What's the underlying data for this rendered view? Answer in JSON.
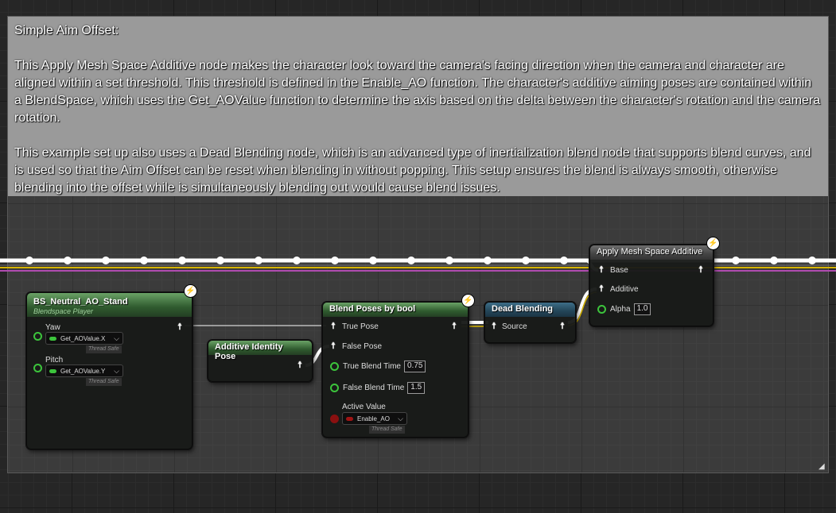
{
  "comment": {
    "title": "Simple Aim Offset:",
    "paragraph1": "This Apply Mesh Space Additive node makes the character look toward the camera's facing direction when the camera and character are aligned within a set threshold. This threshold is defined in the Enable_AO function. The character's additive aiming poses are contained within a BlendSpace, which uses the Get_AOValue function to determine the axis based on the delta between the character's rotation and the camera rotation.",
    "paragraph2": "This example set up also uses a Dead Blending node, which is an advanced type of inertialization blend node that supports blend curves, and is used so that the Aim Offset can be reset when blending in without popping. This setup ensures the blend is always smooth, otherwise blending into the offset while is simultaneously blending out would cause blend issues.",
    "resize_glyph": "◢"
  },
  "nodes": {
    "blendspace": {
      "title": "BS_Neutral_AO_Stand",
      "subtitle": "Blendspace Player",
      "yaw_label": "Yaw",
      "yaw_function": "Get_AOValue.X",
      "pitch_label": "Pitch",
      "pitch_function": "Get_AOValue.Y",
      "thread_safe": "Thread Safe"
    },
    "additive_identity": {
      "title": "Additive Identity Pose"
    },
    "blend_poses": {
      "title": "Blend Poses by bool",
      "true_pose": "True Pose",
      "false_pose": "False Pose",
      "true_blend_time_label": "True Blend Time",
      "true_blend_time": "0.75",
      "false_blend_time_label": "False Blend Time",
      "false_blend_time": "1.5",
      "active_value_label": "Active Value",
      "active_value_function": "Enable_AO",
      "thread_safe": "Thread Safe"
    },
    "dead_blending": {
      "title": "Dead Blending",
      "source": "Source"
    },
    "apply_additive": {
      "title": "Apply Mesh Space Additive",
      "base": "Base",
      "additive": "Additive",
      "alpha_label": "Alpha",
      "alpha": "1.0"
    }
  },
  "icons": {
    "pose": "person-pose-icon",
    "bolt": "lightning-bolt-icon",
    "chevron": "chevron-down-icon"
  },
  "colors": {
    "pose_wire": "#ffffff",
    "float_pin": "#3cc43c",
    "bool_pin": "#8a1010",
    "exec_wire_yellow": "#d6b400",
    "exec_wire_magenta": "#b04cb0"
  }
}
